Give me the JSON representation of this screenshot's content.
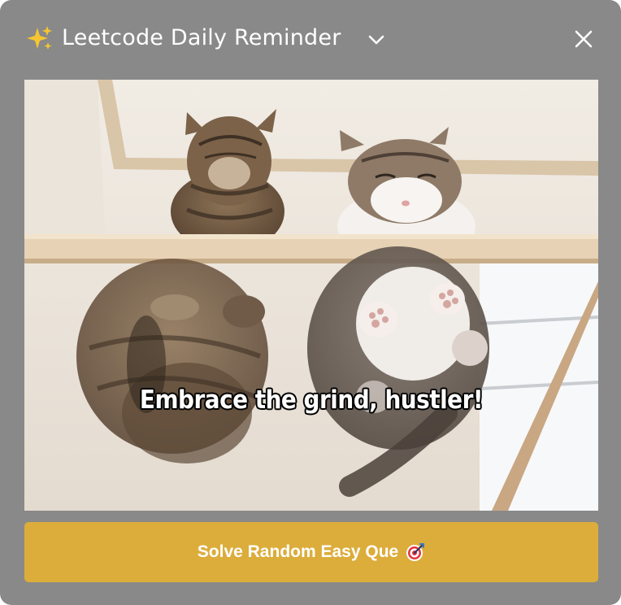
{
  "window": {
    "title": "Leetcode Daily Reminder",
    "title_icon": "sparkles-icon",
    "collapse_icon": "chevron-down-icon",
    "close_icon": "close-icon"
  },
  "image": {
    "subject": "two cats sitting on a glass shelf viewed from below",
    "caption": "Embrace the grind, hustler!"
  },
  "action": {
    "label": "Solve Random Easy Que",
    "icon": "target-dart-icon"
  },
  "colors": {
    "window_background": "#898989",
    "button_background": "#dcad3b",
    "text": "#ffffff"
  }
}
